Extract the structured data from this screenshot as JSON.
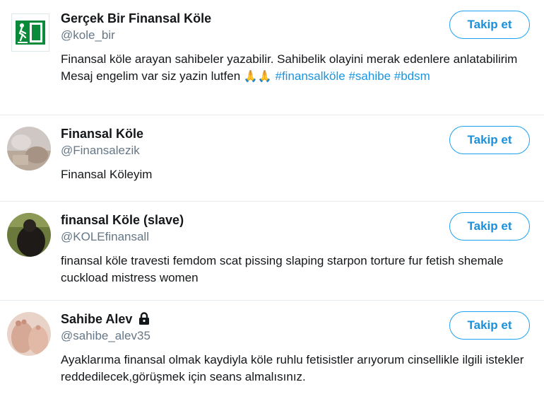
{
  "accounts": [
    {
      "name": "Gerçek Bir Finansal Köle",
      "handle": "@kole_bir",
      "bio_text": "Finansal köle arayan sahibeler yazabilir. Sahibelik olayini merak edenlere anlatabilirim Mesaj engelim var siz yazin lutfen",
      "bio_emoji": "🙏🙏",
      "hashtags": [
        "#finansalköle",
        "#sahibe",
        "#bdsm"
      ],
      "follow_label": "Takip et",
      "avatar_icon": "exit-sign-icon"
    },
    {
      "name": "Finansal Köle",
      "handle": "@Finansalezik",
      "bio_text": "Finansal Köleyim",
      "follow_label": "Takip et",
      "avatar_icon": "profile-photo"
    },
    {
      "name": "finansal Köle (slave)",
      "handle": "@KOLEfinansall",
      "bio_text": "finansal köle travesti femdom scat pissing slaping starpon torture fur fetish shemale cuckload mistress women",
      "follow_label": "Takip et",
      "avatar_icon": "profile-photo"
    },
    {
      "name": "Sahibe Alev",
      "handle": "@sahibe_alev35",
      "bio_text": "Ayaklarıma finansal olmak kaydiyla köle ruhlu fetisistler arıyorum cinsellikle ilgili istekler reddedilecek,görüşmek için seans almalısınız.",
      "follow_label": "Takip et",
      "avatar_icon": "profile-photo",
      "protected_icon": "lock-icon"
    }
  ],
  "colors": {
    "accent": "#1da1f2",
    "hashtag": "#1b95e0",
    "handle": "#657786",
    "divider": "#e6ecf0"
  }
}
